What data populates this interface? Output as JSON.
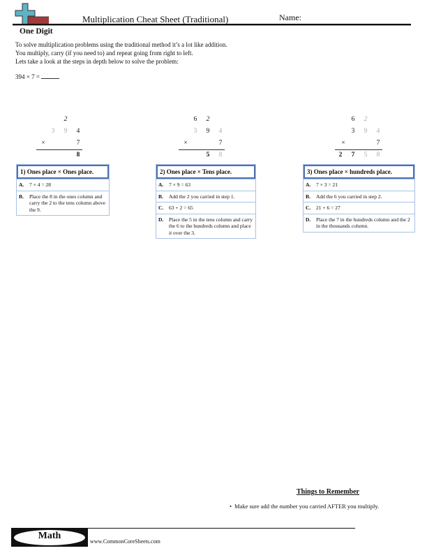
{
  "header": {
    "title": "Multiplication Cheat Sheet (Traditional)",
    "name_label": "Name:",
    "logo_icon": "plus-logo-icon"
  },
  "subtitle": "One Digit",
  "intro": {
    "lines": [
      "To solve multiplication problems using the traditional method it’s a lot like addition.",
      "You multiply, carry (if you need to) and repeat going from right to left.",
      "Lets take a look at the steps in depth below to solve the problem:"
    ]
  },
  "problem": {
    "text": "394 × 7 ="
  },
  "work": [
    {
      "carry": [
        "",
        "",
        "2"
      ],
      "top": [
        "3",
        "9",
        "4"
      ],
      "times": "×",
      "bottom": "7",
      "result": [
        "",
        "",
        "",
        "8"
      ]
    },
    {
      "carry": [
        "",
        "6",
        "2"
      ],
      "top": [
        "3",
        "9",
        "4"
      ],
      "times": "×",
      "bottom": "7",
      "result": [
        "",
        "",
        "5",
        "8"
      ]
    },
    {
      "carry": [
        "",
        "6",
        "2"
      ],
      "top": [
        "3",
        "9",
        "4"
      ],
      "times": "×",
      "bottom": "7",
      "result": [
        "2",
        "7",
        "5",
        "8"
      ]
    }
  ],
  "steps": [
    {
      "title": "1) Ones place × Ones place.",
      "items": [
        {
          "label": "A.",
          "text": "7 × 4 = 28"
        },
        {
          "label": "B.",
          "text": "Place the 8 in the ones column and carry the 2 to the tens column above the 9."
        }
      ]
    },
    {
      "title": "2) Ones place × Tens place.",
      "items": [
        {
          "label": "A.",
          "text": "7 × 9 = 63"
        },
        {
          "label": "B.",
          "text": "Add the 2 you carried in step 1."
        },
        {
          "label": "C.",
          "text": "63 + 2 = 65"
        },
        {
          "label": "D.",
          "text": "Place the 5 in the tens column and carry the 6 to the hundreds column and place it over the 3."
        }
      ]
    },
    {
      "title": "3) Ones place × hundreds place.",
      "items": [
        {
          "label": "A.",
          "text": "7 × 3 = 21"
        },
        {
          "label": "B.",
          "text": "Add the 6 you carried in step 2."
        },
        {
          "label": "C.",
          "text": "21 + 6 = 27"
        },
        {
          "label": "D.",
          "text": "Place the 7 in the hundreds column and the 2 in the thousands column."
        }
      ]
    }
  ],
  "remember": {
    "title": "Things to Remember",
    "items": [
      "Make sure add the number you carried AFTER you multiply."
    ]
  },
  "footer": {
    "badge": "Math",
    "site": "www.CommonCoreSheets.com"
  },
  "colors": {
    "step_border": "#4e71b0",
    "row_border": "#a9c1e6",
    "logo_plus": "#5fb3c4",
    "logo_bar": "#a33a3a"
  }
}
